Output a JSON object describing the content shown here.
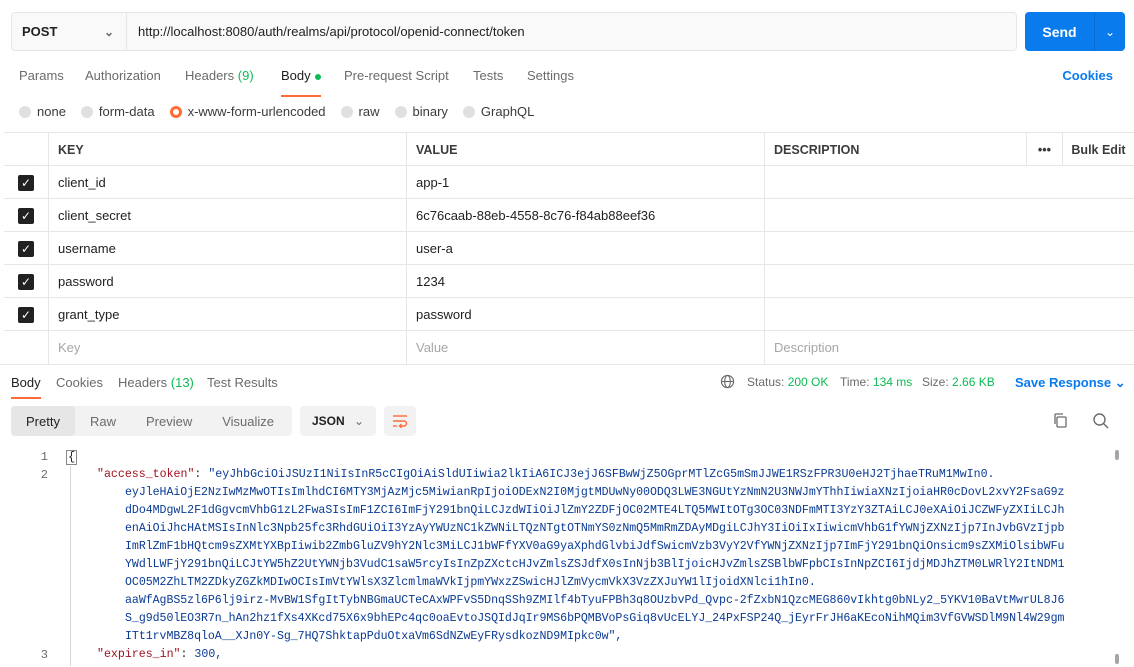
{
  "request": {
    "method": "POST",
    "url": "http://localhost:8080/auth/realms/api/protocol/openid-connect/token",
    "send_label": "Send"
  },
  "tabs": [
    {
      "label": "Params"
    },
    {
      "label": "Authorization"
    },
    {
      "label": "Headers",
      "count": "(9)"
    },
    {
      "label": "Body"
    },
    {
      "label": "Pre-request Script"
    },
    {
      "label": "Tests"
    },
    {
      "label": "Settings"
    }
  ],
  "cookies_label": "Cookies",
  "body_types": [
    "none",
    "form-data",
    "x-www-form-urlencoded",
    "raw",
    "binary",
    "GraphQL"
  ],
  "params_table": {
    "headers": {
      "key": "KEY",
      "value": "VALUE",
      "description": "DESCRIPTION",
      "bulk_edit": "Bulk Edit",
      "more": "•••"
    },
    "rows": [
      {
        "key": "client_id",
        "value": "app-1",
        "checked": true
      },
      {
        "key": "client_secret",
        "value": "6c76caab-88eb-4558-8c76-f84ab88eef36",
        "checked": true
      },
      {
        "key": "username",
        "value": "user-a",
        "checked": true
      },
      {
        "key": "password",
        "value": "1234",
        "checked": true
      },
      {
        "key": "grant_type",
        "value": "password",
        "checked": true
      }
    ],
    "placeholders": {
      "key": "Key",
      "value": "Value",
      "description": "Description"
    }
  },
  "response": {
    "tabs": [
      {
        "label": "Body"
      },
      {
        "label": "Cookies"
      },
      {
        "label": "Headers",
        "count": "(13)"
      },
      {
        "label": "Test Results"
      }
    ],
    "status_label": "Status:",
    "status_value": "200 OK",
    "time_label": "Time:",
    "time_value": "134 ms",
    "size_label": "Size:",
    "size_value": "2.66 KB",
    "save_label": "Save Response",
    "formats": [
      "Pretty",
      "Raw",
      "Preview",
      "Visualize"
    ],
    "language": "JSON",
    "line_numbers": [
      "1",
      "2",
      "3"
    ],
    "open_brace": "{",
    "access_token_key": "\"access_token\"",
    "access_token_lines": [
      "\"eyJhbGciOiJSUzI1NiIsInR5cCIgOiAiSldUIiwia2lkIiA6ICJ3ejJ6SFBwWjZ5OGprMTlZcG5mSmJJWE1RSzFPR3U0eHJ2TjhaeTRuM1MwIn0.",
      "eyJleHAiOjE2NzIwMzMwOTIsImlhdCI6MTY3MjAzMjc5MiwianRpIjoiODExN2I0MjgtMDUwNy00ODQ3LWE3NGUtYzNmN2U3NWJmYThhIiwiaXNzIjoiaHR0cDovL2xvY2FsaG9z",
      "dDo4MDgwL2F1dGgvcmVhbG1zL2FwaSIsImF1ZCI6ImFjY291bnQiLCJzdWIiOiJlZmY2ZDFjOC02MTE4LTQ5MWItOTg3OC03NDFmMTI3YzY3ZTAiLCJ0eXAiOiJCZWFyZXIiLCJh",
      "enAiOiJhcHAtMSIsInNlc3Npb25fc3RhdGUiOiI3YzAyYWUzNC1kZWNiLTQzNTgtOTNmYS0zNmQ5MmRmZDAyMDgiLCJhY3IiOiIxIiwicmVhbG1fYWNjZXNzIjp7InJvbGVzIjpb",
      "ImRlZmF1bHQtcm9sZXMtYXBpIiwib2ZmbGluZV9hY2Nlc3MiLCJ1bWFfYXV0aG9yaXphdGlvbiJdfSwicmVzb3VyY2VfYWNjZXNzIjp7ImFjY291bnQiOnsicm9sZXMiOlsibWFu",
      "YWdlLWFjY291bnQiLCJtYW5hZ2UtYWNjb3VudC1saW5rcyIsInZpZXctcHJvZmlsZSJdfX0sInNjb3BlIjoicHJvZmlsZSBlbWFpbCIsInNpZCI6IjdjMDJhZTM0LWRlY2ItNDM1",
      "OC05M2ZhLTM2ZDkyZGZkMDIwOCIsImVtYWlsX3ZlcmlmaWVkIjpmYWxzZSwicHJlZmVycmVkX3VzZXJuYW1lIjoidXNlci1hIn0.",
      "aaWfAgBS5zl6P6lj9irz-MvBW1SfgItTybNBGmaUCTeCAxWPFvS5DnqSSh9ZMIlf4bTyuFPBh3q8OUzbvPd_Qvpc-2fZxbN1QzcMEG860vIkhtg0bNLy2_5YKV10BaVtMwrUL8J6",
      "S_g9d50lEO3R7n_hAn2hz1fXs4XKcd75X6x9bhEPc4qc0oaEvtoJSQIdJqIr9MS6bPQMBVoPsGiq8vUcELYJ_24PxFSP24Q_jEyrFrJH6aKEcoNihMQim3VfGVWSDlM9Nl4W29gm",
      "ITt1rvMBZ8qloA__XJn0Y-Sg_7HQ7ShktapPduOtxaVm6SdNZwEyFRysdkozND9MIpkc0w\","
    ],
    "expires_key": "\"expires_in\"",
    "expires_value": "300,"
  }
}
